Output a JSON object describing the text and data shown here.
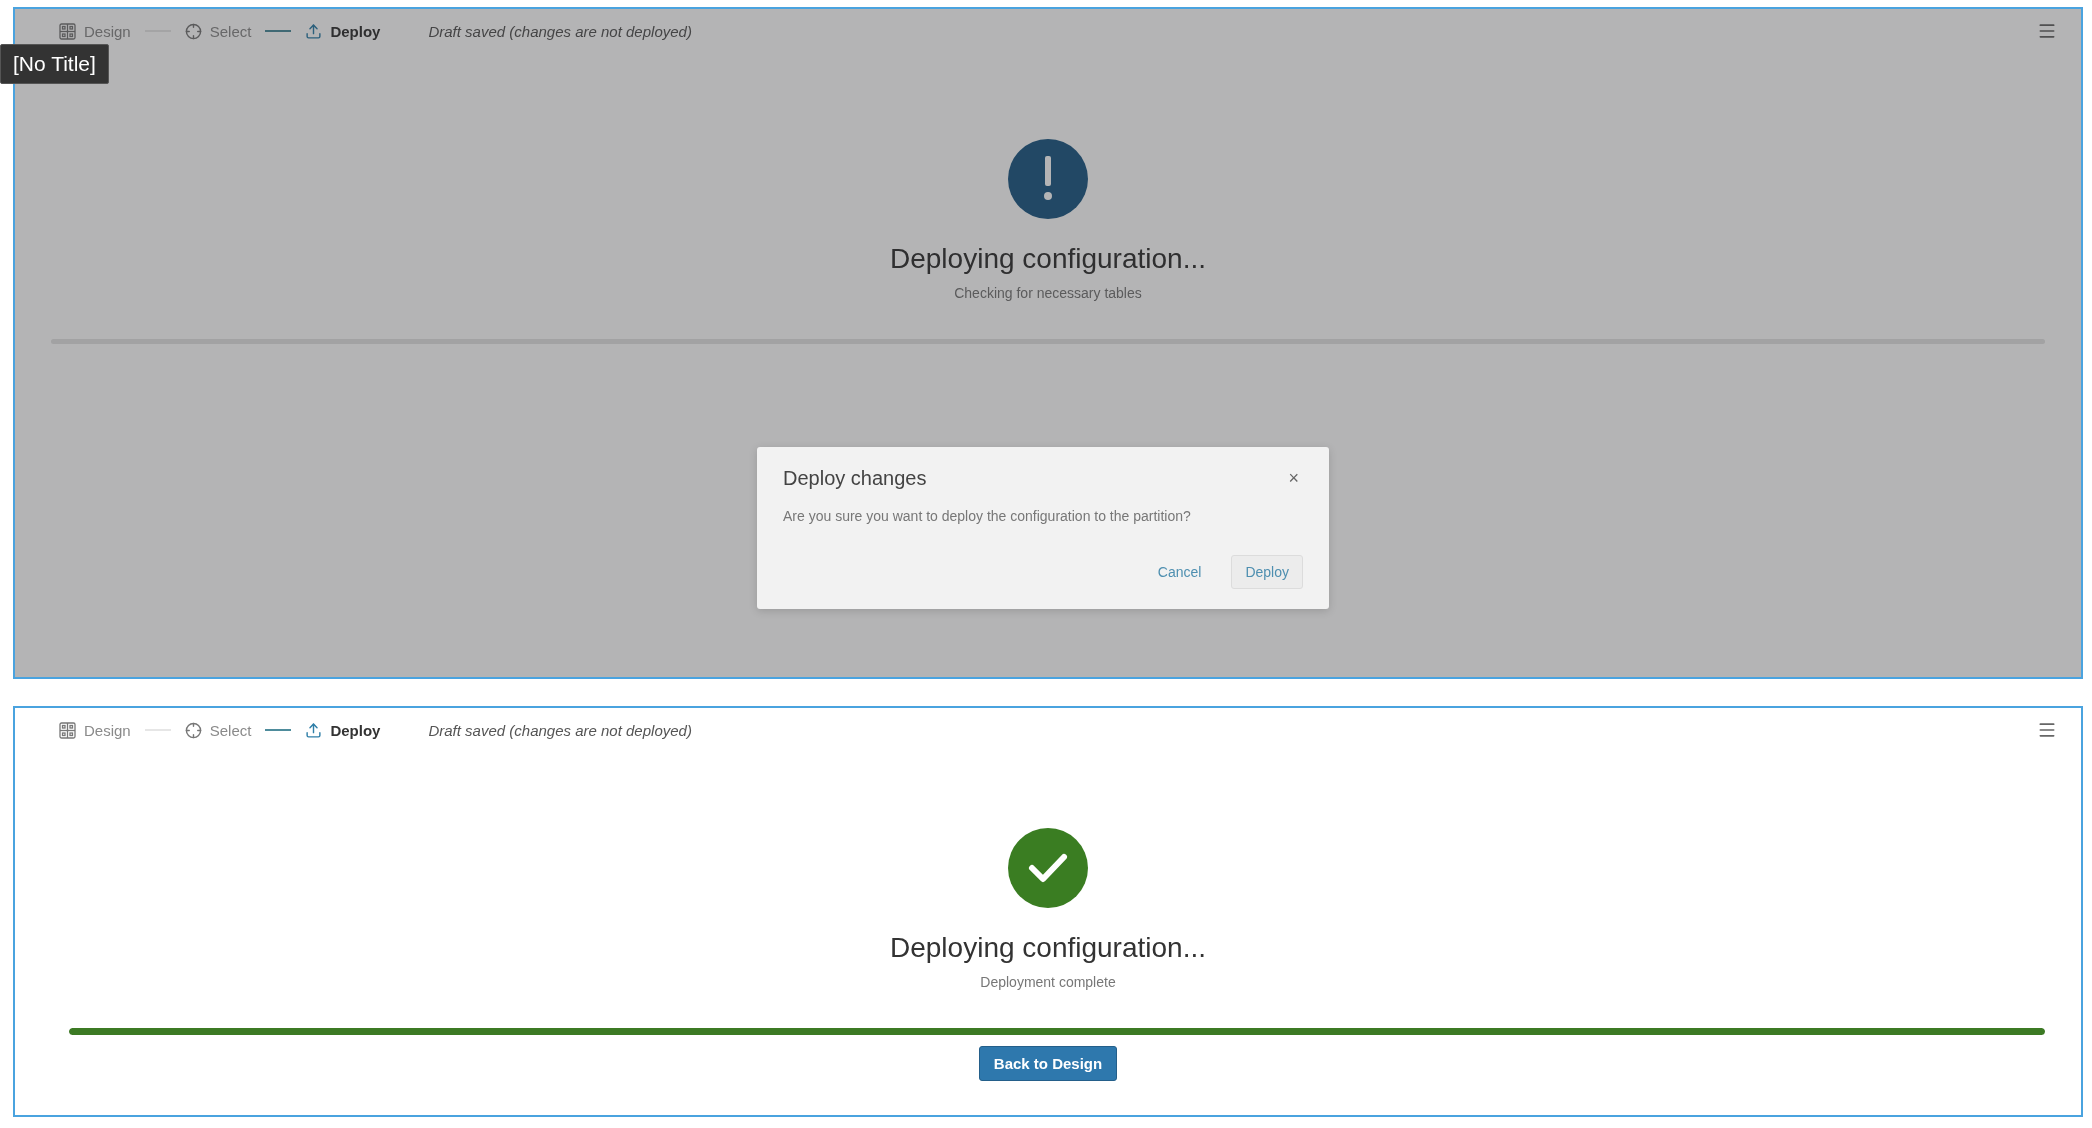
{
  "tooltip": "[No Title]",
  "panels": [
    {
      "steps": [
        {
          "label": "Design",
          "selected": false
        },
        {
          "label": "Select",
          "selected": false
        },
        {
          "label": "Deploy",
          "selected": true
        }
      ],
      "status": "Draft saved (changes are not deployed)",
      "kind": "pending",
      "title": "Deploying configuration...",
      "subtitle": "Checking for necessary tables",
      "level": 0,
      "dialog": {
        "title": "Deploy changes",
        "close": "×",
        "message": "Are you sure you want to deploy the configuration to the partition?",
        "buttons": [
          {
            "label": "Cancel",
            "kind": "link"
          },
          {
            "label": "Deploy",
            "kind": "default"
          }
        ]
      }
    },
    {
      "steps": [
        {
          "label": "Design",
          "selected": false
        },
        {
          "label": "Select",
          "selected": false
        },
        {
          "label": "Deploy",
          "selected": true
        }
      ],
      "status": "Draft saved (changes are not deployed)",
      "kind": "success",
      "title": "Deploying configuration...",
      "subtitle": "Deployment complete",
      "level": 1,
      "action": "Back to Design"
    }
  ]
}
